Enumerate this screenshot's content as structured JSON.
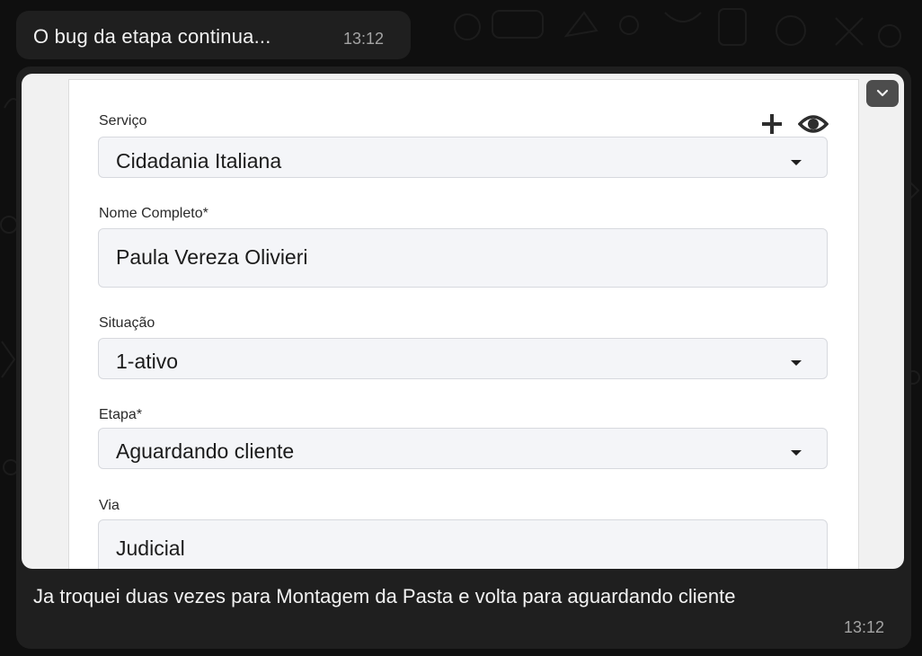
{
  "chat": {
    "message1": {
      "text": "O bug da etapa continua...",
      "time": "13:12"
    },
    "message2": {
      "text": "Ja troquei duas vezes para Montagem da Pasta e volta para aguardando cliente",
      "time": "13:12"
    }
  },
  "screenshot_form": {
    "servico": {
      "label": "Serviço",
      "value": "Cidadania Italiana"
    },
    "nome": {
      "label": "Nome Completo*",
      "value": "Paula Vereza Olivieri"
    },
    "situacao": {
      "label": "Situação",
      "value": "1-ativo"
    },
    "etapa": {
      "label": "Etapa*",
      "value": "Aguardando cliente"
    },
    "via": {
      "label": "Via",
      "value": "Judicial"
    }
  },
  "icons": {
    "add": "plus-icon",
    "view": "eye-icon",
    "expand": "chevron-down-icon"
  },
  "colors": {
    "background": "#0f0f0f",
    "bubble": "#1f1f1f",
    "text": "#f2f2f2",
    "timestamp": "#a4a4a4"
  }
}
